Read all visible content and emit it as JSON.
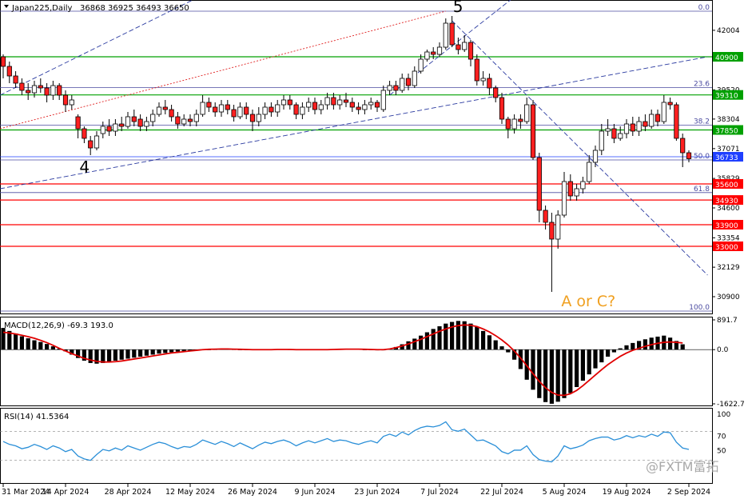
{
  "header": {
    "symbol": "Japan225,Daily",
    "ohlc": "36868 36925 36493 36650"
  },
  "macd_label": "MACD(12,26,9) -69.3 193.0",
  "rsi_label": "RSI(14) 41.5364",
  "watermark": "@FXTM富拓",
  "chart_data": {
    "type": "candlestick",
    "title": "Japan225,Daily",
    "price_range": [
      30200,
      43200
    ],
    "price_ticks": [
      42004,
      39520,
      38304,
      37071,
      35829,
      34600,
      33354,
      32129,
      30900
    ],
    "x_labels": [
      "31 Mar 2024",
      "14 Apr 2024",
      "28 Apr 2024",
      "12 May 2024",
      "26 May 2024",
      "9 Jun 2024",
      "23 Jun 2024",
      "7 Jul 2024",
      "22 Jul 2024",
      "5 Aug 2024",
      "19 Aug 2024",
      "2 Sep 2024"
    ],
    "horizontal_levels": [
      {
        "price": 40900,
        "color": "#00a000",
        "label": "40900"
      },
      {
        "price": 39310,
        "color": "#00a000",
        "label": "39310"
      },
      {
        "price": 37850,
        "color": "#00a000",
        "label": "37850"
      },
      {
        "price": 35600,
        "color": "#ff0000",
        "label": "35600"
      },
      {
        "price": 34930,
        "color": "#ff0000",
        "label": "34930"
      },
      {
        "price": 33900,
        "color": "#ff0000",
        "label": "33900"
      },
      {
        "price": 33000,
        "color": "#ff0000",
        "label": "33000"
      }
    ],
    "current_price": {
      "price": 36733,
      "label": "36733",
      "color": "#1f3fff"
    },
    "fib_levels": [
      {
        "label": "0.0",
        "price": 42800
      },
      {
        "label": "23.6",
        "price": 39620
      },
      {
        "label": "38.2",
        "price": 38050
      },
      {
        "label": "50.0",
        "price": 36600
      },
      {
        "label": "61.8",
        "price": 35240
      },
      {
        "label": "100.0",
        "price": 30300
      }
    ],
    "wave_labels": [
      {
        "text": "4",
        "color": "#000000"
      },
      {
        "text": "5",
        "color": "#000000"
      },
      {
        "text": "A or C?",
        "color": "#f0a020"
      }
    ],
    "candles": [
      [
        40900,
        40500,
        41000,
        40000
      ],
      [
        40500,
        40100,
        40700,
        39800
      ],
      [
        40100,
        39800,
        40300,
        39600
      ],
      [
        39800,
        39500,
        40000,
        39300
      ],
      [
        39500,
        39400,
        39800,
        39100
      ],
      [
        39400,
        39700,
        39900,
        39200
      ],
      [
        39700,
        39600,
        40000,
        39400
      ],
      [
        39600,
        39300,
        39800,
        39000
      ],
      [
        39300,
        39700,
        39900,
        39100
      ],
      [
        39700,
        39300,
        39800,
        39100
      ],
      [
        39300,
        38900,
        39500,
        38600
      ],
      [
        38900,
        39100,
        39300,
        38700
      ],
      [
        38400,
        37900,
        38500,
        37500
      ],
      [
        37900,
        37500,
        38000,
        37300
      ],
      [
        37400,
        37100,
        37600,
        36800
      ],
      [
        37100,
        37600,
        37800,
        37000
      ],
      [
        37700,
        38000,
        38200,
        37500
      ],
      [
        38000,
        37800,
        38300,
        37600
      ],
      [
        37800,
        38100,
        38300,
        37600
      ],
      [
        38100,
        38000,
        38400,
        37800
      ],
      [
        38000,
        38400,
        38600,
        37900
      ],
      [
        38400,
        38200,
        38700,
        38000
      ],
      [
        38300,
        38000,
        38500,
        37800
      ],
      [
        38000,
        38200,
        38400,
        37800
      ],
      [
        38200,
        38500,
        38700,
        38000
      ],
      [
        38500,
        38800,
        39000,
        38400
      ],
      [
        38800,
        38700,
        39100,
        38500
      ],
      [
        38700,
        38400,
        38900,
        38200
      ],
      [
        38400,
        38100,
        38600,
        37900
      ],
      [
        38100,
        38300,
        38500,
        38000
      ],
      [
        38300,
        38200,
        38500,
        38000
      ],
      [
        38200,
        38500,
        38700,
        38000
      ],
      [
        38500,
        39000,
        39300,
        38400
      ],
      [
        39000,
        38800,
        39200,
        38600
      ],
      [
        38800,
        38600,
        39000,
        38400
      ],
      [
        38600,
        38900,
        39100,
        38400
      ],
      [
        38900,
        38700,
        39100,
        38500
      ],
      [
        38700,
        38400,
        38900,
        38200
      ],
      [
        38400,
        38800,
        39000,
        38300
      ],
      [
        38800,
        38500,
        39000,
        38300
      ],
      [
        38500,
        38200,
        38700,
        37800
      ],
      [
        38200,
        38500,
        38800,
        38000
      ],
      [
        38500,
        38800,
        39000,
        38300
      ],
      [
        38800,
        38600,
        39000,
        38400
      ],
      [
        38600,
        38900,
        39100,
        38400
      ],
      [
        38900,
        39100,
        39300,
        38700
      ],
      [
        39100,
        38900,
        39300,
        38700
      ],
      [
        38900,
        38500,
        39000,
        38300
      ],
      [
        38500,
        38800,
        39000,
        38300
      ],
      [
        38800,
        39000,
        39200,
        38600
      ],
      [
        39000,
        38700,
        39200,
        38500
      ],
      [
        38700,
        38900,
        39100,
        38500
      ],
      [
        38900,
        39200,
        39400,
        38700
      ],
      [
        39200,
        38900,
        39400,
        38700
      ],
      [
        38900,
        39100,
        39300,
        38700
      ],
      [
        39100,
        39000,
        39400,
        38800
      ],
      [
        39000,
        38800,
        39200,
        38600
      ],
      [
        38800,
        38700,
        39000,
        38500
      ],
      [
        38700,
        38900,
        39100,
        38500
      ],
      [
        38900,
        39000,
        39200,
        38700
      ],
      [
        39000,
        38800,
        39100,
        38600
      ],
      [
        38700,
        39500,
        39700,
        38600
      ],
      [
        39500,
        39700,
        39900,
        39300
      ],
      [
        39700,
        39500,
        39900,
        39300
      ],
      [
        39500,
        40000,
        40200,
        39400
      ],
      [
        40000,
        39700,
        40200,
        39500
      ],
      [
        39700,
        40300,
        40500,
        39600
      ],
      [
        40300,
        40800,
        41000,
        40200
      ],
      [
        40800,
        41100,
        41200,
        40700
      ],
      [
        41100,
        41000,
        41300,
        40800
      ],
      [
        41000,
        41300,
        41500,
        40900
      ],
      [
        41300,
        42300,
        42500,
        41200
      ],
      [
        42300,
        41400,
        42600,
        41300
      ],
      [
        41400,
        41200,
        41700,
        41000
      ],
      [
        41200,
        41500,
        41800,
        41100
      ],
      [
        41500,
        40800,
        41600,
        40500
      ],
      [
        40800,
        39900,
        41000,
        39700
      ],
      [
        39900,
        40000,
        40300,
        39700
      ],
      [
        40000,
        39600,
        40200,
        39300
      ],
      [
        39600,
        39200,
        39700,
        39000
      ],
      [
        39200,
        38300,
        39400,
        38100
      ],
      [
        38300,
        37900,
        38400,
        37500
      ],
      [
        37900,
        38300,
        38500,
        37700
      ],
      [
        38300,
        38200,
        38500,
        37900
      ],
      [
        38200,
        38900,
        39200,
        38100
      ],
      [
        38900,
        36700,
        39100,
        36600
      ],
      [
        36700,
        34500,
        36900,
        34000
      ],
      [
        34500,
        34000,
        34700,
        33700
      ],
      [
        34000,
        33300,
        34400,
        31100
      ],
      [
        33300,
        34300,
        34500,
        32900
      ],
      [
        34300,
        35700,
        36100,
        34200
      ],
      [
        35700,
        35100,
        36000,
        34900
      ],
      [
        35100,
        35400,
        35600,
        34900
      ],
      [
        35400,
        35700,
        35900,
        35200
      ],
      [
        35700,
        36500,
        36800,
        35600
      ],
      [
        36500,
        37000,
        37200,
        36300
      ],
      [
        37000,
        37800,
        38100,
        36800
      ],
      [
        37800,
        37900,
        38300,
        37600
      ],
      [
        37900,
        37500,
        38100,
        37300
      ],
      [
        37500,
        37700,
        38000,
        37400
      ],
      [
        37700,
        38100,
        38300,
        37500
      ],
      [
        38100,
        37800,
        38400,
        37600
      ],
      [
        37800,
        38200,
        38400,
        37600
      ],
      [
        38200,
        38000,
        38500,
        37800
      ],
      [
        38000,
        38500,
        38700,
        37900
      ],
      [
        38500,
        38200,
        38700,
        38000
      ],
      [
        38200,
        39000,
        39300,
        38100
      ],
      [
        39000,
        38900,
        39200,
        38700
      ],
      [
        38900,
        37500,
        39000,
        37400
      ],
      [
        37500,
        36900,
        37700,
        36300
      ],
      [
        36900,
        36650,
        37000,
        36500
      ]
    ],
    "macd_range": [
      -1622.7,
      891.7
    ],
    "macd_ticks": [
      891.7,
      0.0,
      -1622.7
    ],
    "macd": {
      "histogram": [
        650,
        560,
        480,
        400,
        340,
        280,
        230,
        170,
        100,
        30,
        -50,
        -150,
        -250,
        -330,
        -400,
        -420,
        -400,
        -360,
        -330,
        -300,
        -270,
        -240,
        -210,
        -180,
        -150,
        -120,
        -100,
        -80,
        -60,
        -40,
        -30,
        -20,
        -10,
        0,
        5,
        10,
        10,
        5,
        0,
        -5,
        -10,
        -5,
        0,
        5,
        10,
        10,
        5,
        0,
        -10,
        -15,
        -10,
        0,
        5,
        10,
        20,
        30,
        20,
        10,
        0,
        -10,
        -20,
        -20,
        20,
        80,
        160,
        250,
        330,
        420,
        520,
        620,
        700,
        780,
        830,
        860,
        850,
        780,
        680,
        560,
        430,
        280,
        100,
        -80,
        -300,
        -580,
        -900,
        -1200,
        -1450,
        -1570,
        -1620,
        -1560,
        -1450,
        -1300,
        -1120,
        -930,
        -740,
        -560,
        -380,
        -210,
        -80,
        40,
        130,
        200,
        260,
        310,
        360,
        390,
        420,
        360,
        260,
        160
      ],
      "signal": [
        520,
        500,
        470,
        430,
        390,
        340,
        280,
        210,
        130,
        40,
        -40,
        -120,
        -190,
        -260,
        -310,
        -350,
        -370,
        -370,
        -360,
        -340,
        -310,
        -280,
        -250,
        -220,
        -190,
        -160,
        -130,
        -100,
        -80,
        -60,
        -40,
        -20,
        0,
        10,
        15,
        20,
        20,
        15,
        10,
        5,
        0,
        0,
        0,
        0,
        5,
        5,
        5,
        0,
        0,
        0,
        0,
        0,
        0,
        5,
        10,
        15,
        15,
        15,
        10,
        5,
        0,
        0,
        20,
        60,
        110,
        170,
        240,
        310,
        390,
        470,
        550,
        620,
        680,
        720,
        740,
        730,
        690,
        620,
        530,
        420,
        290,
        140,
        -40,
        -250,
        -480,
        -720,
        -950,
        -1140,
        -1280,
        -1360,
        -1370,
        -1320,
        -1220,
        -1080,
        -920,
        -760,
        -600,
        -450,
        -320,
        -200,
        -100,
        -20,
        40,
        100,
        150,
        190,
        220,
        230,
        220,
        200
      ]
    },
    "rsi_ticks": [
      100,
      70,
      50
    ],
    "rsi": [
      56,
      52,
      50,
      46,
      48,
      52,
      49,
      45,
      50,
      47,
      42,
      45,
      36,
      32,
      30,
      38,
      45,
      43,
      47,
      44,
      50,
      47,
      44,
      48,
      52,
      55,
      53,
      49,
      46,
      49,
      48,
      52,
      58,
      55,
      52,
      56,
      53,
      49,
      54,
      50,
      46,
      51,
      55,
      53,
      56,
      58,
      55,
      50,
      54,
      57,
      54,
      57,
      60,
      56,
      58,
      57,
      54,
      52,
      55,
      57,
      54,
      63,
      66,
      63,
      69,
      65,
      71,
      75,
      77,
      76,
      78,
      83,
      72,
      70,
      73,
      65,
      57,
      58,
      54,
      50,
      42,
      39,
      44,
      44,
      50,
      38,
      31,
      29,
      28,
      36,
      50,
      46,
      48,
      51,
      57,
      60,
      62,
      62,
      58,
      60,
      64,
      61,
      64,
      62,
      66,
      63,
      69,
      68,
      55,
      47,
      45
    ]
  }
}
